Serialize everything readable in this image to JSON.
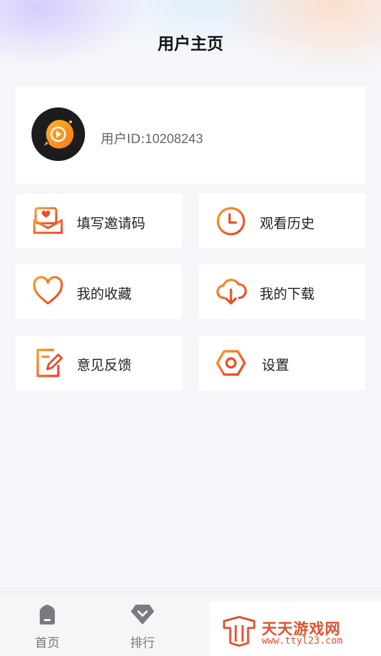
{
  "header": {
    "title": "用户主页"
  },
  "profile": {
    "user_id_label": "用户ID:",
    "user_id": "10208243"
  },
  "menu": [
    {
      "label": "填写邀请码",
      "icon": "envelope-heart-icon"
    },
    {
      "label": "观看历史",
      "icon": "clock-icon"
    },
    {
      "label": "我的收藏",
      "icon": "heart-icon"
    },
    {
      "label": "我的下载",
      "icon": "cloud-download-icon"
    },
    {
      "label": "意见反馈",
      "icon": "edit-note-icon"
    },
    {
      "label": "设置",
      "icon": "settings-hex-icon"
    }
  ],
  "bottom_nav": [
    {
      "label": "首页",
      "icon": "home-icon"
    },
    {
      "label": "排行",
      "icon": "ranking-diamond-icon"
    }
  ],
  "watermark": {
    "title": "天天游戏网",
    "url": "www.ttyl23.com"
  },
  "colors": {
    "accent_start": "#ff9a1f",
    "accent_end": "#ee3b22",
    "background": "#f5f6fa"
  }
}
